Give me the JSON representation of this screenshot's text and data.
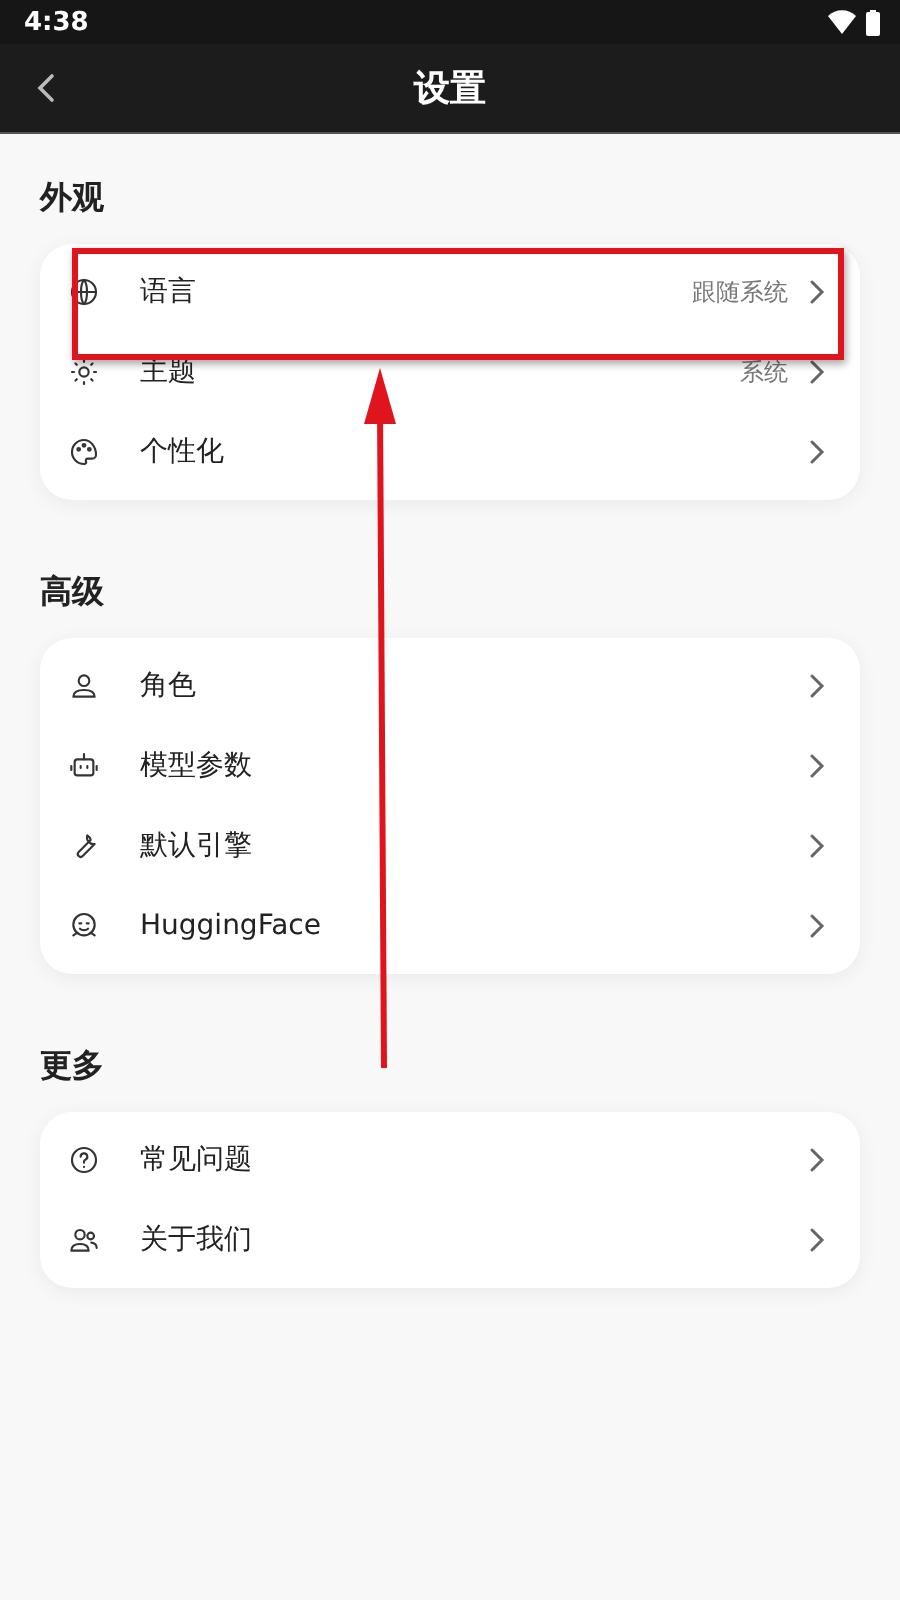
{
  "status_bar": {
    "time": "4:38"
  },
  "app_bar": {
    "title": "设置"
  },
  "sections": [
    {
      "title": "外观",
      "items": [
        {
          "label": "语言",
          "value": "跟随系统"
        },
        {
          "label": "主题",
          "value": "系统"
        },
        {
          "label": "个性化"
        }
      ]
    },
    {
      "title": "高级",
      "items": [
        {
          "label": "角色"
        },
        {
          "label": "模型参数"
        },
        {
          "label": "默认引擎"
        },
        {
          "label": "HuggingFace"
        }
      ]
    },
    {
      "title": "更多",
      "items": [
        {
          "label": "常见问题"
        },
        {
          "label": "关于我们"
        }
      ]
    }
  ]
}
